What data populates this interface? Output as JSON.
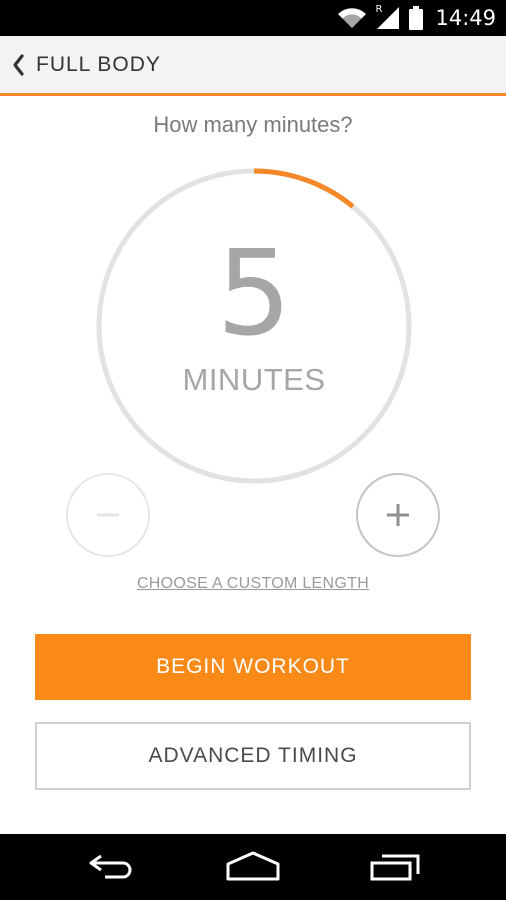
{
  "status_bar": {
    "time": "14:49",
    "roaming_indicator": "R",
    "icons": [
      "wifi-icon",
      "signal-icon",
      "battery-icon"
    ]
  },
  "header": {
    "back_icon": "chevron-left-icon",
    "title": "FULL BODY"
  },
  "main": {
    "prompt": "How many minutes?",
    "dial": {
      "value": "5",
      "unit": "MINUTES",
      "progress_fraction": 0.11
    },
    "decrease_icon": "minus-icon",
    "increase_icon": "plus-icon",
    "custom_length_link": "CHOOSE A CUSTOM LENGTH",
    "begin_button": "BEGIN WORKOUT",
    "advanced_button": "ADVANCED TIMING"
  },
  "nav_bar": {
    "icons": [
      "back-icon",
      "home-icon",
      "recents-icon"
    ]
  },
  "colors": {
    "accent": "#fa8a17",
    "header_bg": "#f3f3f3",
    "dial_track": "#e2e2e2",
    "text_gray": "#a6a6a6"
  }
}
